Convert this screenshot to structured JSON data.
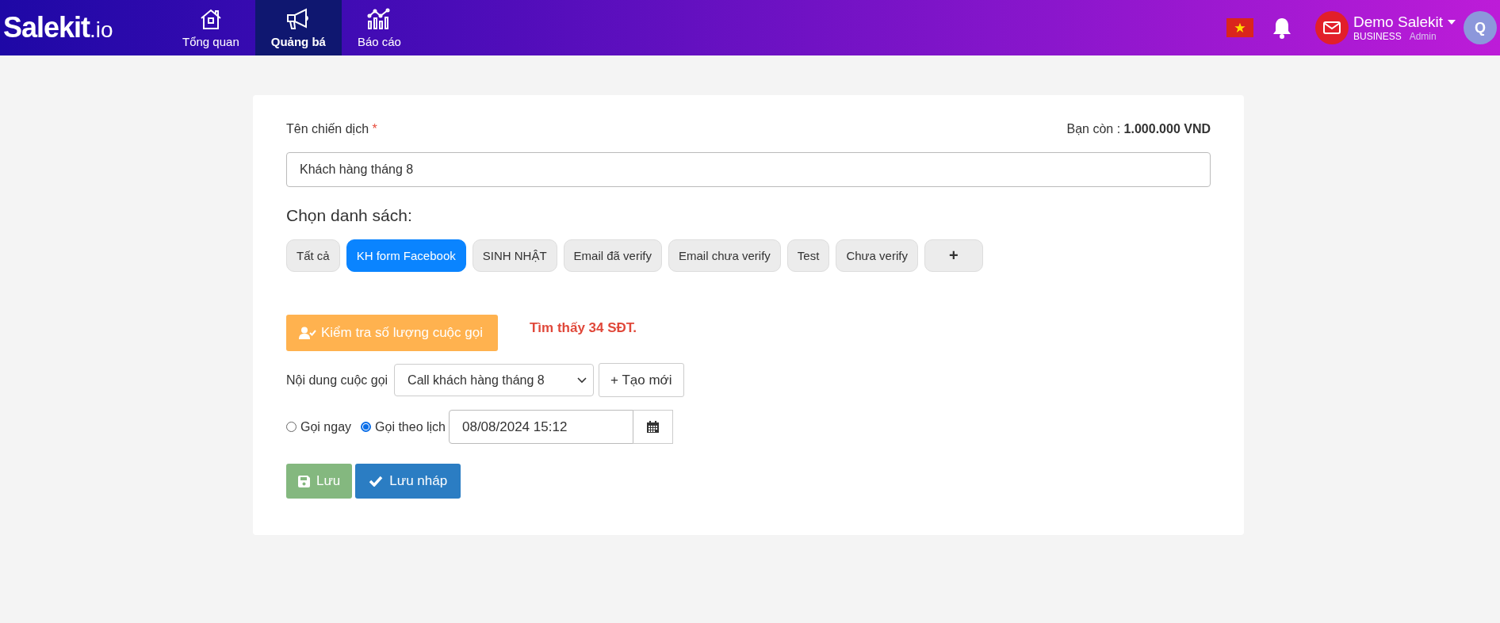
{
  "header": {
    "logo": {
      "name": "Salekit",
      "suffix": ".io"
    },
    "nav": [
      {
        "label": "Tổng quan",
        "kind": "home",
        "selected": false
      },
      {
        "label": "Quảng bá",
        "kind": "megaphone",
        "selected": true
      },
      {
        "label": "Báo cáo",
        "kind": "chart",
        "selected": false
      }
    ],
    "user": {
      "name": "Demo Salekit",
      "plan": "BUSINESS",
      "role": "Admin",
      "avatar": "Q"
    }
  },
  "form": {
    "campaign_label": "Tên chiến dịch",
    "required_mark": "*",
    "balance_label": "Bạn còn :",
    "balance": "1.000.000 VND",
    "campaign_name": "Khách hàng tháng 8",
    "list_heading": "Chọn danh sách:",
    "lists": [
      {
        "label": "Tất cả",
        "kind": "list",
        "selected": false
      },
      {
        "label": "KH form Facebook",
        "kind": "list",
        "selected": true
      },
      {
        "label": "SINH NHẬT",
        "kind": "list",
        "selected": false
      },
      {
        "label": "Email đã verify",
        "kind": "list",
        "selected": false
      },
      {
        "label": "Email chưa verify",
        "kind": "list",
        "selected": false
      },
      {
        "label": "Test",
        "kind": "list",
        "selected": false
      },
      {
        "label": "Chưa verify",
        "kind": "list",
        "selected": false
      },
      {
        "label": "+",
        "kind": "add",
        "selected": false
      }
    ],
    "check_button": "Kiểm tra số lượng cuộc gọi",
    "found_text": "Tìm thấy 34 SĐT.",
    "script_label": "Nội dung cuộc gọi",
    "script_value": "Call khách hàng tháng 8",
    "create_button": "+ Tạo mới",
    "call_modes": [
      {
        "label": "Gọi ngay",
        "selected": false
      },
      {
        "label": "Gọi theo lịch",
        "selected": true
      }
    ],
    "schedule": "08/08/2024 15:12",
    "buttons": [
      {
        "label": "Lưu",
        "kind": "save"
      },
      {
        "label": "Lưu nháp",
        "kind": "draft"
      }
    ]
  }
}
